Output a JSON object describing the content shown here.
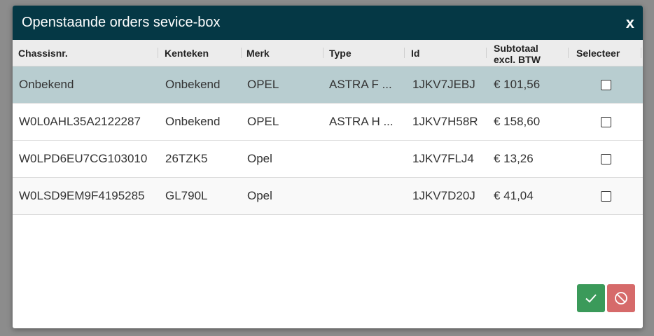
{
  "dialog": {
    "title": "Openstaande orders sevice-box",
    "close_label": "x"
  },
  "table": {
    "columns": [
      "Chassisnr.",
      "Kenteken",
      "Merk",
      "Type",
      "Id",
      "Subtotaal excl. BTW",
      "Selecteer"
    ],
    "subtotaal_line1": "Subtotaal",
    "subtotaal_line2": "excl. BTW",
    "rows": [
      {
        "chassis": "Onbekend",
        "kenteken": "Onbekend",
        "merk": "OPEL",
        "type": "ASTRA F ...",
        "id": "1JKV7JEBJ",
        "subtotaal": "€ 101,56"
      },
      {
        "chassis": "W0L0AHL35A2122287",
        "kenteken": "Onbekend",
        "merk": "OPEL",
        "type": "ASTRA H ...",
        "id": "1JKV7H58R",
        "subtotaal": "€ 158,60"
      },
      {
        "chassis": "W0LPD6EU7CG103010",
        "kenteken": "26TZK5",
        "merk": "Opel",
        "type": "",
        "id": "1JKV7FLJ4",
        "subtotaal": "€ 13,26"
      },
      {
        "chassis": "W0LSD9EM9F4195285",
        "kenteken": "GL790L",
        "merk": "Opel",
        "type": "",
        "id": "1JKV7D20J",
        "subtotaal": "€ 41,04"
      }
    ]
  },
  "buttons": {
    "ok_icon": "checkmark-icon",
    "cancel_icon": "ban-icon"
  },
  "colors": {
    "titlebar": "#053845",
    "selected_row": "#b8cdd0",
    "ok": "#3b9a5a",
    "cancel": "#d66a6a"
  }
}
